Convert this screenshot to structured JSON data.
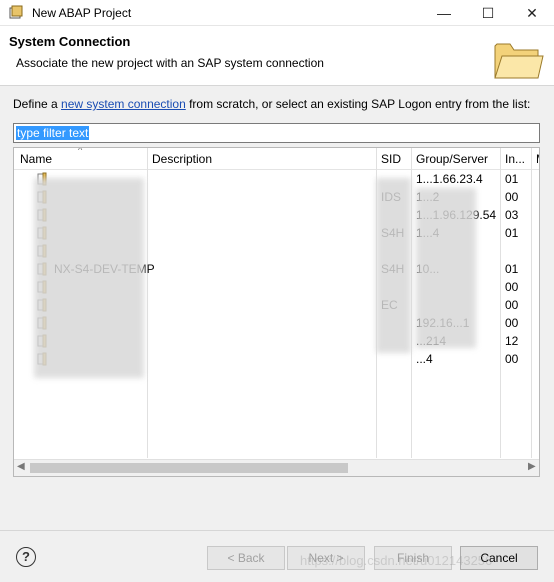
{
  "window": {
    "title": "New ABAP Project",
    "minimize": "—",
    "maximize": "☐",
    "close": "✕"
  },
  "header": {
    "title": "System Connection",
    "description": "Associate the new project with an SAP system connection"
  },
  "intro": {
    "prefix": "Define a ",
    "link": "new system connection",
    "suffix": " from scratch, or select an existing SAP Logon entry from the list:"
  },
  "filter": {
    "value": "type filter text"
  },
  "table": {
    "columns": [
      "Name",
      "Description",
      "SID",
      "Group/Server",
      "In...",
      "M"
    ],
    "rows": [
      {
        "name": "",
        "sid": "",
        "server": "1...1.66.23.4",
        "inst": "01"
      },
      {
        "name": "",
        "sid": "IDS",
        "server": "1...2",
        "inst": "00"
      },
      {
        "name": "",
        "sid": "",
        "server": "1...1.96.129.54",
        "inst": "03"
      },
      {
        "name": "",
        "sid": "S4H",
        "server": "1...4",
        "inst": "01"
      },
      {
        "name": "",
        "sid": "",
        "server": "",
        "inst": ""
      },
      {
        "name": "NX-S4-DEV-TEMP",
        "sid": "S4H",
        "server": "10...",
        "inst": "01"
      },
      {
        "name": "",
        "sid": "",
        "server": "",
        "inst": "00"
      },
      {
        "name": "",
        "sid": "EC",
        "server": "",
        "inst": "00"
      },
      {
        "name": "",
        "sid": "",
        "server": "192.16...1",
        "inst": "00"
      },
      {
        "name": "",
        "sid": "",
        "server": "...214",
        "inst": "12"
      },
      {
        "name": "",
        "sid": "",
        "server": "...4",
        "inst": "00"
      }
    ]
  },
  "footer": {
    "help": "?",
    "back": "< Back",
    "next": "Next >",
    "finish": "Finish",
    "cancel": "Cancel",
    "watermark": "https://blog.csdn.net/u012143256"
  }
}
